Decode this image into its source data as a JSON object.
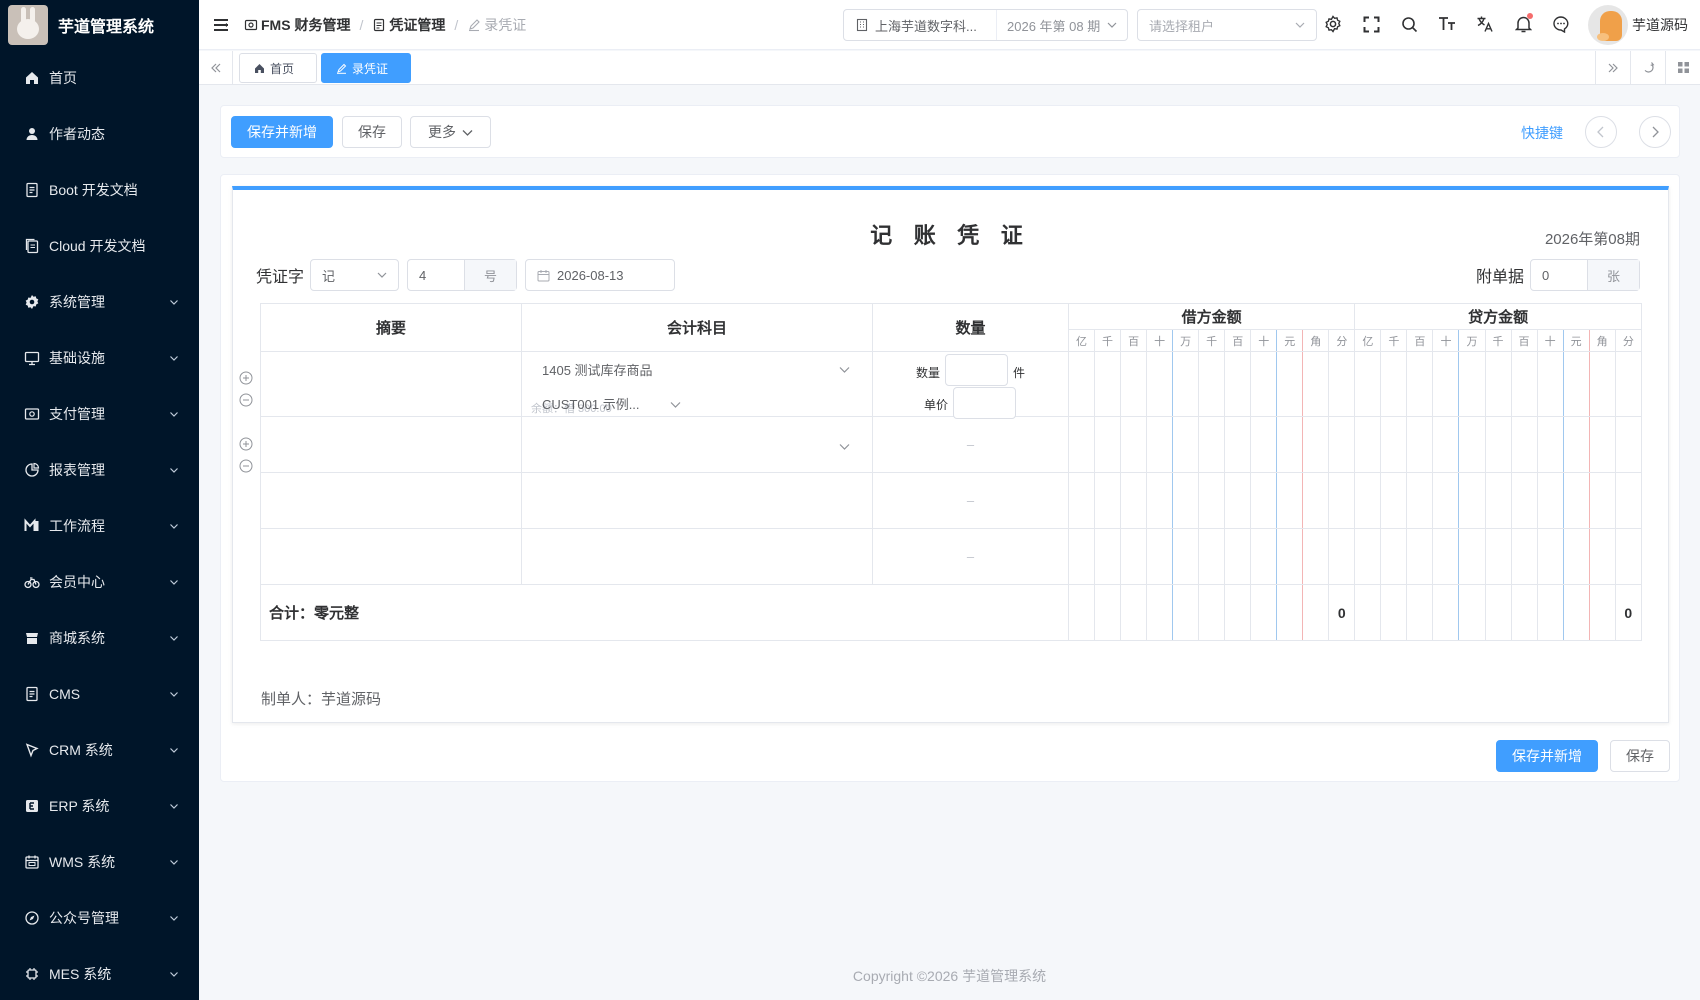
{
  "app": {
    "title": "芋道管理系统"
  },
  "sidebar": {
    "items": [
      {
        "label": "首页",
        "icon": "home-icon",
        "has_children": false
      },
      {
        "label": "作者动态",
        "icon": "user-icon",
        "has_children": false
      },
      {
        "label": "Boot 开发文档",
        "icon": "document-icon",
        "has_children": false
      },
      {
        "label": "Cloud 开发文档",
        "icon": "copy-document-icon",
        "has_children": false
      },
      {
        "label": "系统管理",
        "icon": "gear-icon",
        "has_children": true
      },
      {
        "label": "基础设施",
        "icon": "monitor-icon",
        "has_children": true
      },
      {
        "label": "支付管理",
        "icon": "money-icon",
        "has_children": true
      },
      {
        "label": "报表管理",
        "icon": "pie-chart-icon",
        "has_children": true
      },
      {
        "label": "工作流程",
        "icon": "flow-icon",
        "has_children": true
      },
      {
        "label": "会员中心",
        "icon": "bicycle-icon",
        "has_children": true
      },
      {
        "label": "商城系统",
        "icon": "shop-icon",
        "has_children": true
      },
      {
        "label": "CMS",
        "icon": "document-icon",
        "has_children": true
      },
      {
        "label": "CRM 系统",
        "icon": "crm-icon",
        "has_children": true
      },
      {
        "label": "ERP 系统",
        "icon": "erp-icon",
        "has_children": true
      },
      {
        "label": "WMS 系统",
        "icon": "calendar-icon",
        "has_children": true
      },
      {
        "label": "公众号管理",
        "icon": "compass-icon",
        "has_children": true
      },
      {
        "label": "MES 系统",
        "icon": "chip-icon",
        "has_children": true
      }
    ]
  },
  "header": {
    "breadcrumb": [
      "FMS 财务管理",
      "凭证管理",
      "录凭证"
    ],
    "org": "上海芋道数字科...",
    "period": "2026 年第 08 期",
    "tenant_placeholder": "请选择租户",
    "username": "芋道源码"
  },
  "tags": {
    "home": "首页",
    "current": "录凭证"
  },
  "toolbar": {
    "save_new": "保存并新增",
    "save": "保存",
    "more": "更多",
    "shortcut": "快捷键"
  },
  "voucher": {
    "title": "记 账 凭 证",
    "period": "2026年第08期",
    "word_label": "凭证字",
    "word_value": "记",
    "number_value": "4",
    "number_suffix": "号",
    "date": "2026-08-13",
    "attach_label": "附单据",
    "attach_value": "0",
    "attach_suffix": "张",
    "columns": {
      "summary": "摘要",
      "account": "会计科目",
      "quantity": "数量",
      "debit": "借方金额",
      "credit": "贷方金额"
    },
    "digits": [
      "亿",
      "千",
      "百",
      "十",
      "万",
      "千",
      "百",
      "十",
      "元",
      "角",
      "分"
    ],
    "row1": {
      "account": "1405 测试库存商品",
      "aux": "CUST001 示例...",
      "balance": "余额：借 300.00",
      "qty_label": "数量",
      "qty_unit": "件",
      "price_label": "单价"
    },
    "dash": "–",
    "total_label": "合计：零元整",
    "debit_total": "0",
    "credit_total": "0",
    "maker": "制单人：芋道源码"
  },
  "bottom": {
    "save_new": "保存并新增",
    "save": "保存"
  },
  "footer": "Copyright ©2026 芋道管理系统",
  "colors": {
    "primary": "#409eff",
    "sidebar_bg": "#001529",
    "red_line": "#f3b5b5",
    "blue_line": "#a0c8ef"
  }
}
